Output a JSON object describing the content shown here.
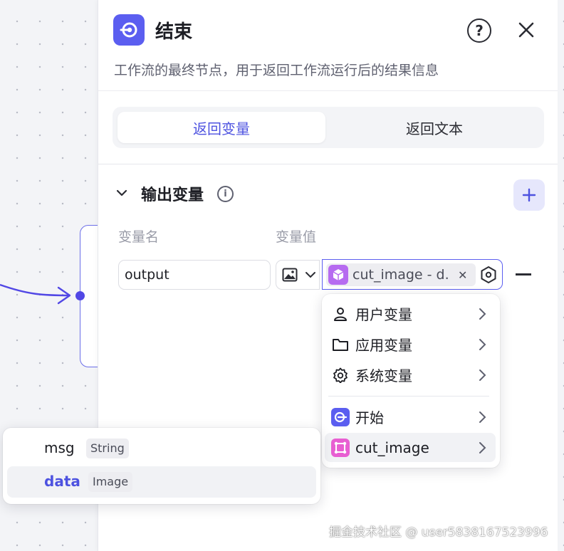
{
  "panel": {
    "title": "结束",
    "description": "工作流的最终节点，用于返回工作流运行后的结果信息",
    "help_icon": "question-circle-icon",
    "close_icon": "close-icon",
    "node_icon": "end-node-icon"
  },
  "tabs": [
    {
      "label": "返回变量",
      "active": true
    },
    {
      "label": "返回文本",
      "active": false
    }
  ],
  "output_section": {
    "title": "输出变量",
    "col_name": "变量名",
    "col_value": "变量值",
    "row": {
      "name_value": "output",
      "type_icon": "image-icon",
      "chip_label": "cut_image - d.",
      "chip_icon": "cube-icon"
    }
  },
  "menu": {
    "items": [
      {
        "label": "用户变量",
        "icon": "user-icon"
      },
      {
        "label": "应用变量",
        "icon": "folder-icon"
      },
      {
        "label": "系统变量",
        "icon": "gear-icon"
      },
      {
        "label": "开始",
        "icon": "start-node-icon"
      },
      {
        "label": "cut_image",
        "icon": "crop-node-icon"
      }
    ]
  },
  "subpopup": {
    "rows": [
      {
        "name": "msg",
        "type": "String"
      },
      {
        "name": "data",
        "type": "Image"
      }
    ]
  },
  "watermark": "掘金技术社区 @ user5838167523996",
  "colors": {
    "accent": "#5b5ef0",
    "accent_text": "#4d52e0",
    "chip_purple": "#b66bf0",
    "crop_pink": "#e85fd2"
  }
}
